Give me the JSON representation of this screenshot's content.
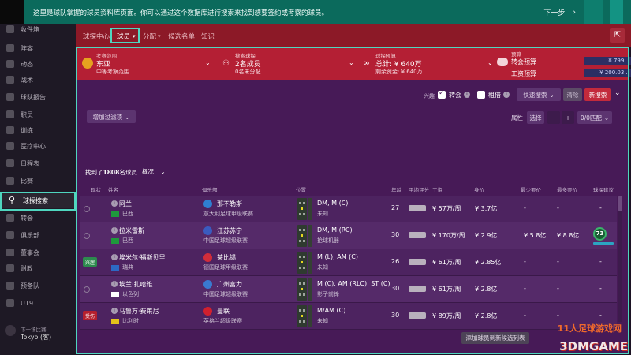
{
  "banner": {
    "text": "这里是球队掌握的球员资料库页面。你可以通过这个数据库进行搜索来找到想要签约或考察的球员。",
    "next_label": "下一步"
  },
  "sidebar": {
    "items": [
      {
        "label": "收件箱"
      },
      {
        "label": "阵容"
      },
      {
        "label": "动态"
      },
      {
        "label": "战术"
      },
      {
        "label": "球队报告"
      },
      {
        "label": "职员"
      },
      {
        "label": "训练"
      },
      {
        "label": "医疗中心"
      },
      {
        "label": "日程表"
      },
      {
        "label": "比赛"
      },
      {
        "label": "球探搜索",
        "active": true
      },
      {
        "label": "转会"
      },
      {
        "label": "俱乐部"
      },
      {
        "label": "董事会"
      },
      {
        "label": "财政"
      },
      {
        "label": "预备队"
      },
      {
        "label": "U19"
      }
    ],
    "footer_label": "下一场比赛",
    "footer_value": "Tokyo (客)"
  },
  "header": {
    "tabs": [
      "球探中心",
      "球员",
      "分配",
      "候选名单",
      "知识"
    ]
  },
  "info": {
    "scope_label": "考察范围",
    "scope_value": "东亚",
    "scope_sub": "中等考察范围",
    "assign_label": "搜索球探",
    "assign_value": "2名成员",
    "assign_sub": "0名未分配",
    "budget_label": "球探预算",
    "budget_value": "总计: ¥ 640万",
    "budget_sub": "剩余资金: ¥ 640万",
    "transfer_label": "预算",
    "transfer_budget_label": "转会预算",
    "transfer_budget_value": "¥ 799...",
    "wage_budget_label": "工资预算",
    "wage_budget_value": "¥ 200.03..."
  },
  "filters": {
    "interest_label": "兴趣",
    "transfer_label": "转会",
    "loan_label": "租借",
    "quick_search_label": "快速搜索",
    "clear_label": "清除",
    "new_search_label": "新搜索",
    "add_filter_label": "增加过滤项",
    "attributes_label": "属性",
    "select_label": "选择",
    "minus": "−",
    "plus": "+",
    "match_label": "0/0匹配"
  },
  "results": {
    "found_prefix": "找到了",
    "found_count": "1808",
    "found_suffix": "名球员",
    "view_label": "概况"
  },
  "table": {
    "headers": [
      "现状",
      "姓名",
      "俱乐部",
      "位置",
      "年龄",
      "平均评分",
      "工资",
      "身价",
      "最少要价",
      "最多要价",
      "球探建议"
    ],
    "rows": [
      {
        "name": "阿兰",
        "nation": "巴西",
        "club": "那不勒斯",
        "league": "意大利足球甲级联赛",
        "position": "DM, M (C)",
        "role": "未知",
        "age": "27",
        "wage": "¥ 57万/周",
        "value": "¥ 3.7亿",
        "min": "-",
        "max": "-",
        "rec": "-",
        "tag": "",
        "flag": "#1e9a3c",
        "badge": "#2f7fd1"
      },
      {
        "name": "拉米雷斯",
        "nation": "巴西",
        "club": "江苏苏宁",
        "league": "中国足球超级联赛",
        "position": "DM, M (RC)",
        "role": "抢球机器",
        "age": "30",
        "wage": "¥ 170万/周",
        "value": "¥ 2.9亿",
        "min": "¥ 5.8亿",
        "max": "¥ 8.8亿",
        "rec": "73",
        "tag": "",
        "flag": "#1e9a3c",
        "badge": "#3a5bbf"
      },
      {
        "name": "埃米尔·福斯贝里",
        "nation": "瑞典",
        "club": "莱比锡",
        "league": "德国足球甲级联赛",
        "position": "M (L), AM (C)",
        "role": "未知",
        "age": "26",
        "wage": "¥ 61万/周",
        "value": "¥ 2.85亿",
        "min": "-",
        "max": "-",
        "rec": "-",
        "tag": "兴趣",
        "flag": "#2d68c4",
        "badge": "#d12d3a"
      },
      {
        "name": "埃兰·扎哈维",
        "nation": "以色列",
        "club": "广州富力",
        "league": "中国足球超级联赛",
        "position": "M (C), AM (RLC), ST (C)",
        "role": "影子前锋",
        "age": "30",
        "wage": "¥ 61万/周",
        "value": "¥ 2.8亿",
        "min": "-",
        "max": "-",
        "rec": "-",
        "tag": "",
        "flag": "#ffffff",
        "badge": "#3a7ad0"
      },
      {
        "name": "马鲁万·费莱尼",
        "nation": "比利时",
        "club": "曼联",
        "league": "英格兰超级联赛",
        "position": "M/AM (C)",
        "role": "未知",
        "age": "30",
        "wage": "¥ 89万/周",
        "value": "¥ 2.8亿",
        "min": "-",
        "max": "-",
        "rec": "-",
        "tag": "受伤",
        "flag": "#e3c21a",
        "badge": "#d1202e"
      }
    ]
  },
  "footer": {
    "add_to_list_label": "添加球员到新候选列表"
  },
  "watermark": {
    "line1": "11人足球游戏网",
    "line2": "3DMGAME"
  },
  "colors": {
    "accent_teal": "#4fd6bf",
    "header_red": "#8c1927",
    "info_red": "#b41f34",
    "content_purple": "#471a57",
    "button_red": "#c32a3c"
  }
}
